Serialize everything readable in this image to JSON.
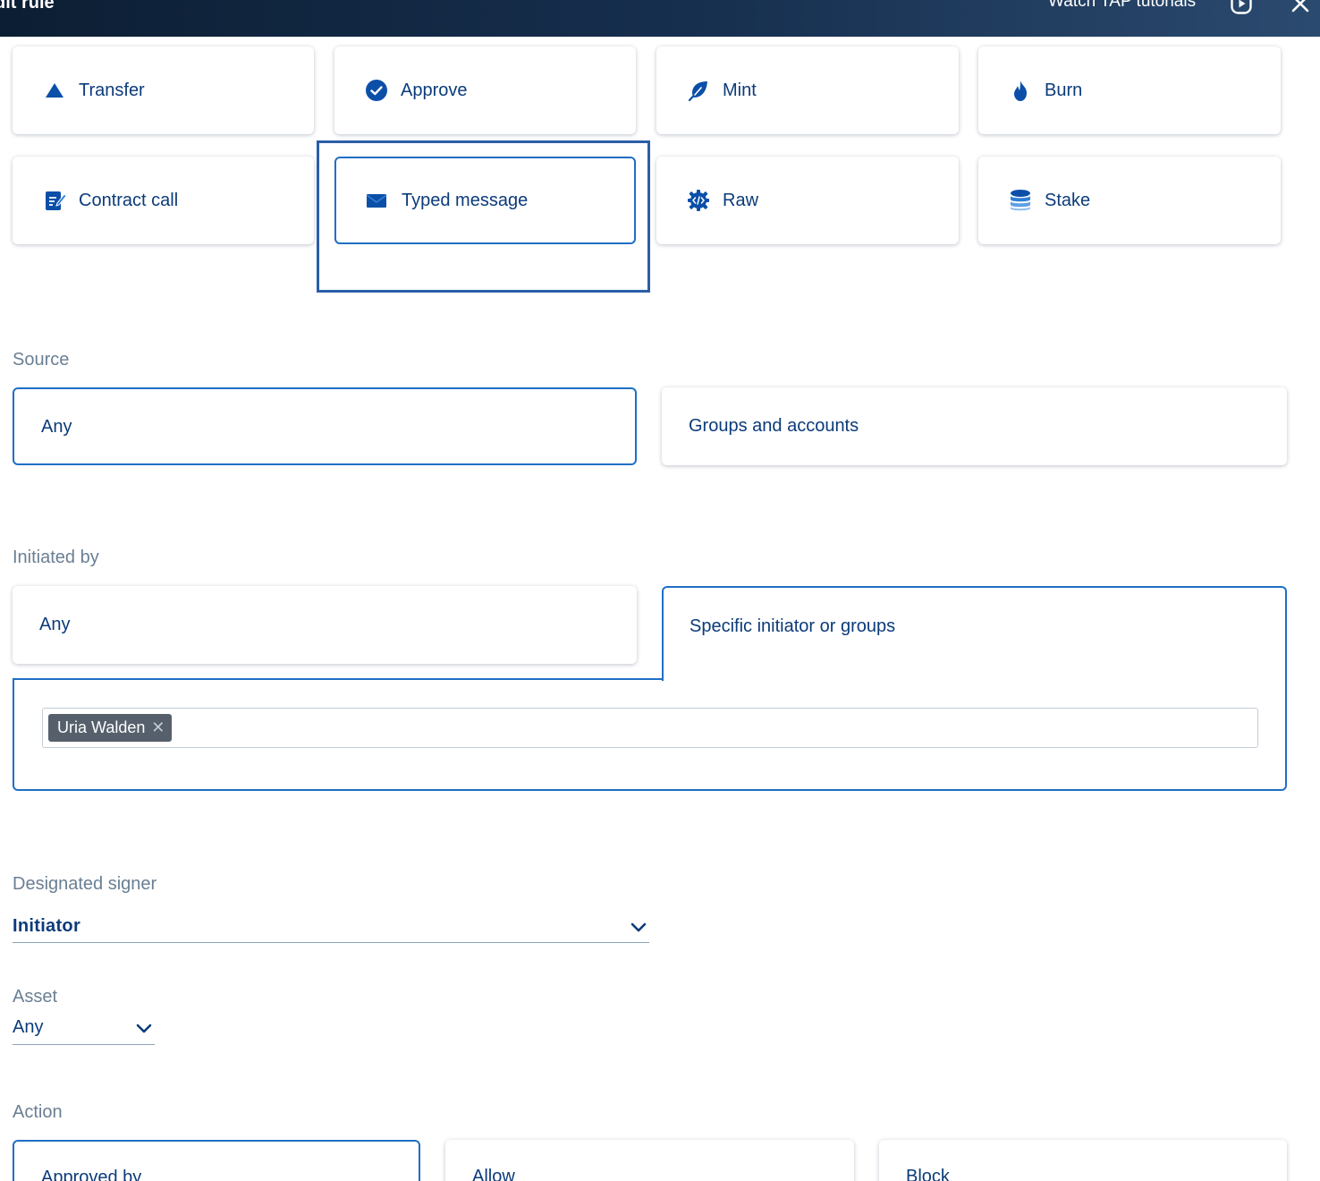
{
  "header": {
    "title": "dit rule",
    "tutorials_label": "Watch TAP tutorials",
    "play_icon": "play-circle-icon",
    "close_icon": "close-icon"
  },
  "types": [
    {
      "label": "Transfer",
      "icon": "triangle-icon"
    },
    {
      "label": "Approve",
      "icon": "check-circle-icon"
    },
    {
      "label": "Mint",
      "icon": "leaf-icon"
    },
    {
      "label": "Burn",
      "icon": "flame-icon"
    },
    {
      "label": "Contract call",
      "icon": "edit-document-icon"
    },
    {
      "label": "Typed message",
      "icon": "envelope-icon",
      "selected": true
    },
    {
      "label": "Raw",
      "icon": "code-gear-icon"
    },
    {
      "label": "Stake",
      "icon": "database-icon"
    }
  ],
  "source": {
    "label": "Source",
    "options": [
      "Any",
      "Groups and accounts"
    ],
    "selected": "Any"
  },
  "initiated_by": {
    "label": "Initiated by",
    "options": [
      "Any",
      "Specific initiator or groups"
    ],
    "selected": "Specific initiator or groups",
    "tags": [
      "Uria Walden"
    ]
  },
  "designated_signer": {
    "label": "Designated signer",
    "value": "Initiator"
  },
  "asset": {
    "label": "Asset",
    "value": "Any"
  },
  "action": {
    "label": "Action",
    "options": [
      "Approved by",
      "Allow",
      "Block"
    ],
    "selected": "Approved by"
  },
  "colors": {
    "accent": "#1f6fc4",
    "text": "#0b3b7a",
    "muted": "#6a7f93",
    "header_bg": "#0c1e33"
  }
}
